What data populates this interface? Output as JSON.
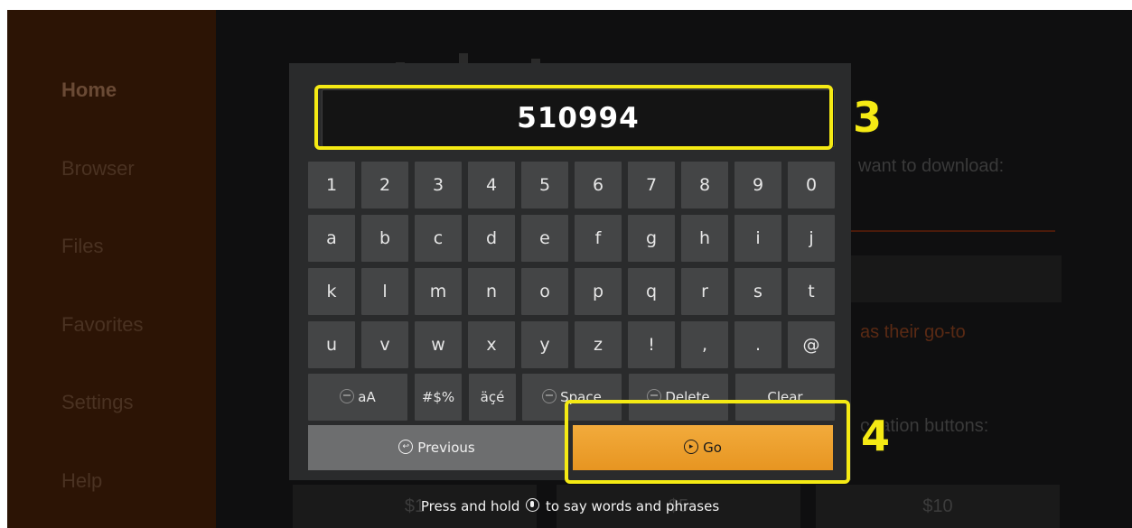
{
  "sidebar": {
    "items": [
      {
        "label": "Home"
      },
      {
        "label": "Browser"
      },
      {
        "label": "Files"
      },
      {
        "label": "Favorites"
      },
      {
        "label": "Settings"
      },
      {
        "label": "Help"
      }
    ]
  },
  "background": {
    "download_text": "want to download:",
    "goto_text": "as their go-to",
    "donation_text": "onation buttons:",
    "amounts": [
      "$1",
      "$5",
      "$10"
    ]
  },
  "keyboard": {
    "input_value": "510994",
    "rows": [
      [
        "1",
        "2",
        "3",
        "4",
        "5",
        "6",
        "7",
        "8",
        "9",
        "0"
      ],
      [
        "a",
        "b",
        "c",
        "d",
        "e",
        "f",
        "g",
        "h",
        "i",
        "j"
      ],
      [
        "k",
        "l",
        "m",
        "n",
        "o",
        "p",
        "q",
        "r",
        "s",
        "t"
      ],
      [
        "u",
        "v",
        "w",
        "x",
        "y",
        "z",
        "!",
        ",",
        ".",
        "@"
      ]
    ],
    "case_label": "aA",
    "symbols_label": "#$%",
    "accents_label": "äçé",
    "space_label": "Space",
    "delete_label": "Delete",
    "clear_label": "Clear",
    "previous_label": "Previous",
    "go_label": "Go",
    "hint_before": "Press and hold",
    "hint_after": "to say words and phrases"
  },
  "annotations": {
    "step_input": "3",
    "step_go": "4",
    "highlight_color": "#f5ea14"
  },
  "colors": {
    "accent": "#e99a24",
    "sidebar_bg": "#2c1405",
    "dialog_bg": "#2a2b2c",
    "key_bg": "#444546"
  }
}
